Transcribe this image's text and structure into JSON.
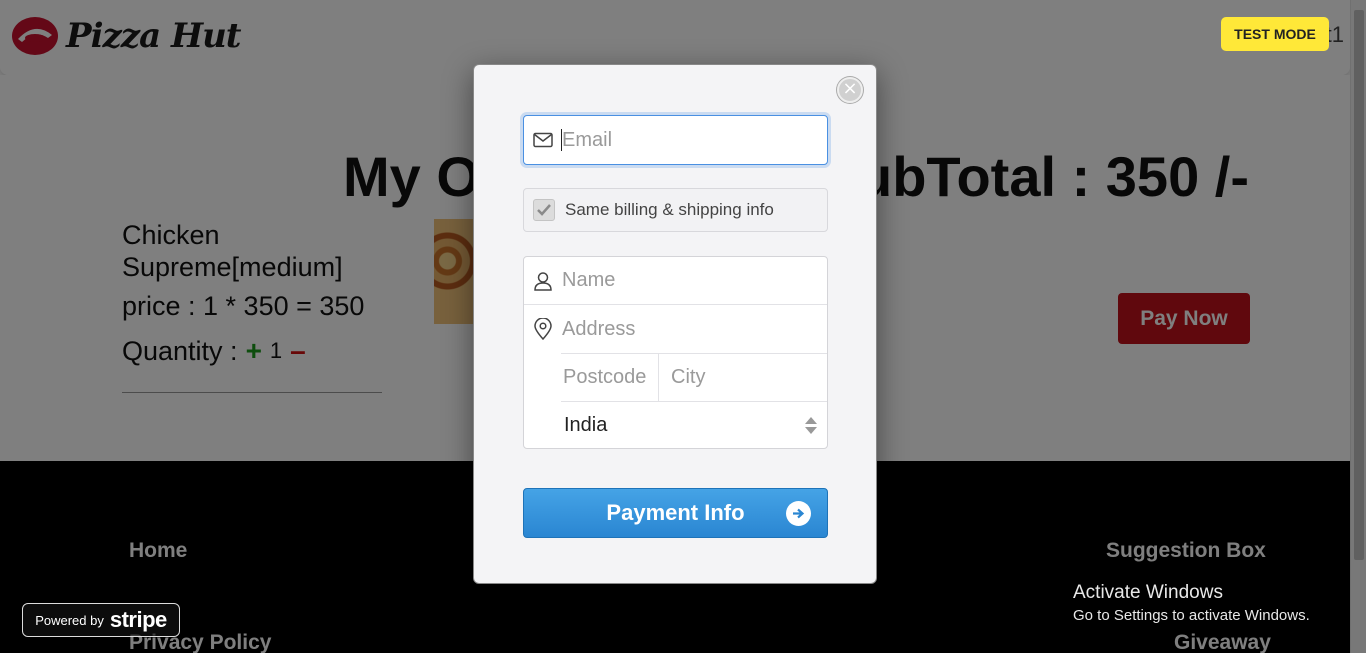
{
  "header": {
    "brand": "Pizza Hut",
    "right_text": "t1"
  },
  "order": {
    "heading_left": "My O",
    "heading_right": "ubTotal : 350 /-",
    "item_name": "Chicken Supreme[medium]",
    "price_line": "price : 1 * 350 = 350",
    "quantity_label": "Quantity :",
    "quantity_plus": "+",
    "quantity_value": "1",
    "quantity_minus": "–",
    "pay_now_label": "Pay Now"
  },
  "footer": {
    "home": "Home",
    "privacy": "Privacy Policy",
    "suggestion": "Suggestion Box",
    "giveaway": "Giveaway"
  },
  "stripe": {
    "test_mode": "TEST MODE",
    "powered_by": "Powered by",
    "stripe_word": "stripe"
  },
  "checkout": {
    "email_placeholder": "Email",
    "same_billing_label": "Same billing & shipping info",
    "same_billing_checked": true,
    "name_placeholder": "Name",
    "address_placeholder": "Address",
    "postcode_placeholder": "Postcode",
    "city_placeholder": "City",
    "country_value": "India",
    "submit_label": "Payment Info",
    "close_symbol": "×"
  },
  "windows_watermark": {
    "line1": "Activate Windows",
    "line2": "Go to Settings to activate Windows."
  },
  "colors": {
    "brand_red": "#c0101a",
    "stripe_blue": "#2a86d2",
    "test_mode_yellow": "#ffe838",
    "qty_plus_green": "#1a9a1a",
    "qty_minus_red": "#d01010"
  }
}
